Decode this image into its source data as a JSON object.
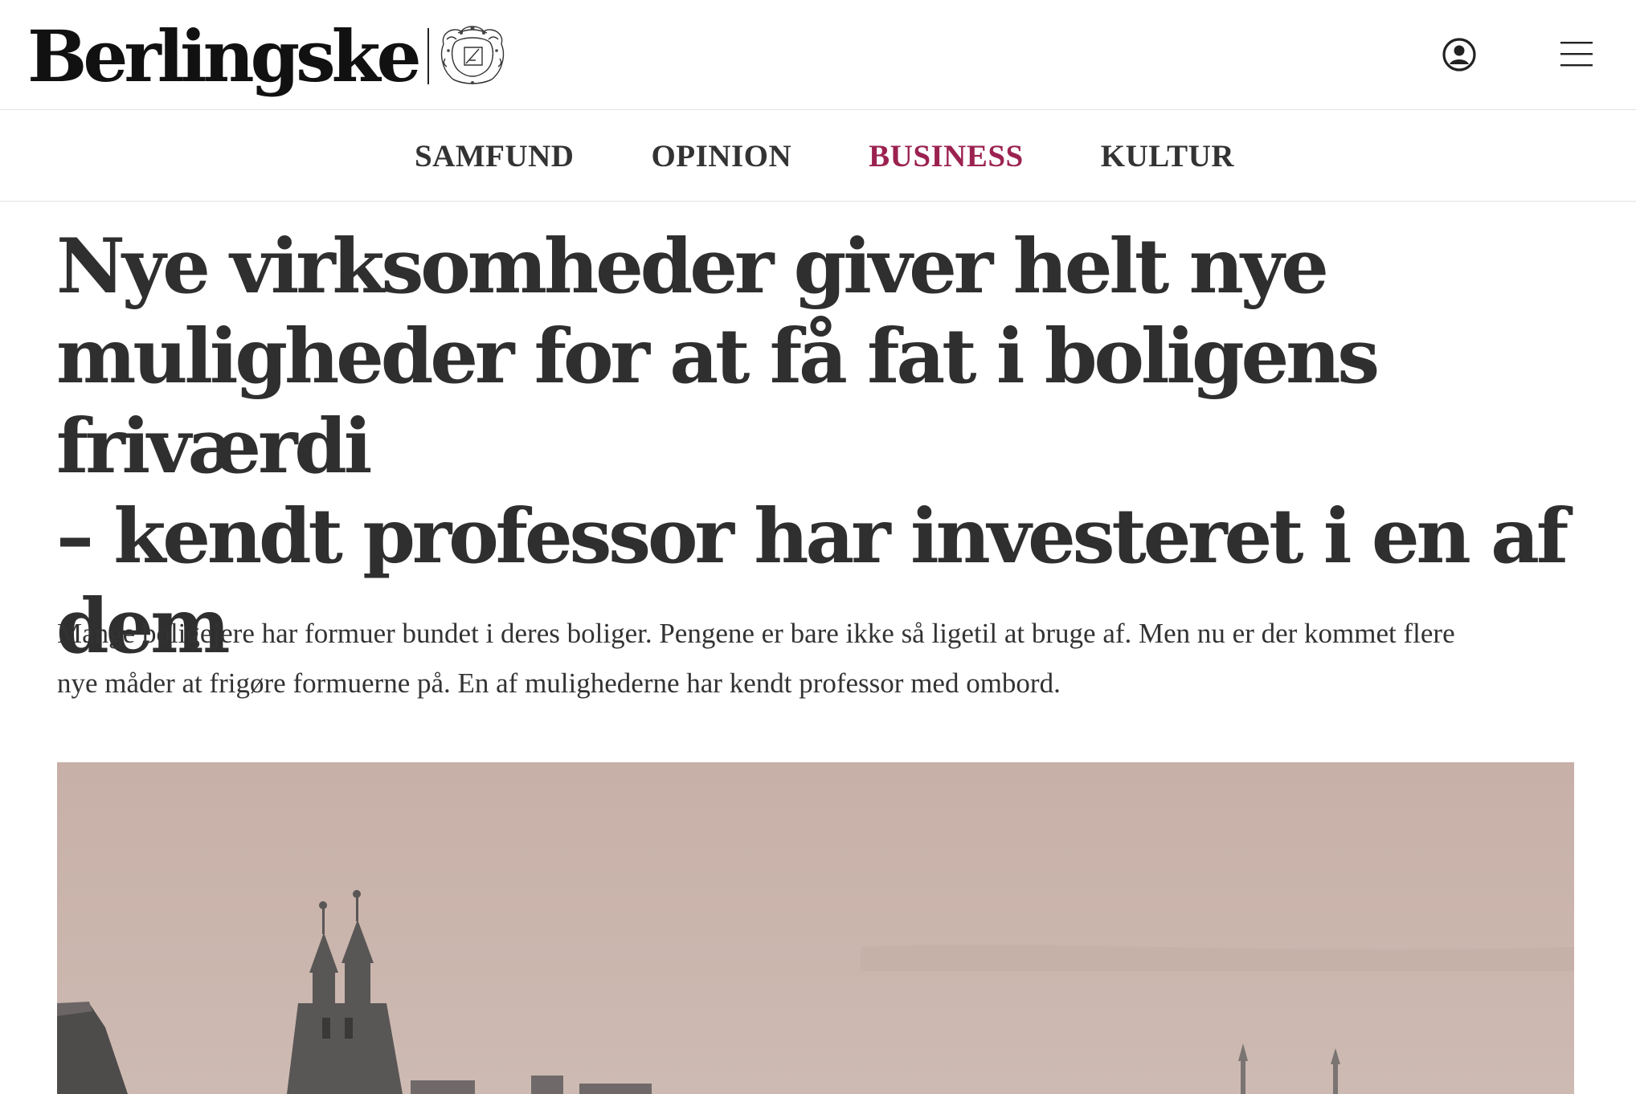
{
  "header": {
    "logo_text": "Berlingske",
    "user_icon": "user-circle-icon",
    "menu_icon": "hamburger-menu-icon"
  },
  "nav": {
    "items": [
      {
        "label": "SAMFUND",
        "active": false
      },
      {
        "label": "OPINION",
        "active": false
      },
      {
        "label": "BUSINESS",
        "active": true
      },
      {
        "label": "KULTUR",
        "active": false
      }
    ]
  },
  "article": {
    "headline_lines": [
      "Nye virksomheder giver helt nye",
      "muligheder for at få fat i boligens friværdi",
      "– kendt professor har investeret i en af",
      "dem"
    ],
    "lead_lines": [
      "Mange boligejere har formuer bundet i deres boliger. Pengene er bare ikke så ligetil at bruge af. Men nu er der kommet flere",
      "nye måder at frigøre formuerne på. En af mulighederne har kendt professor med ombord."
    ]
  },
  "colors": {
    "accent": "#9b2250",
    "text": "#333333",
    "border": "#e2e2e2"
  }
}
